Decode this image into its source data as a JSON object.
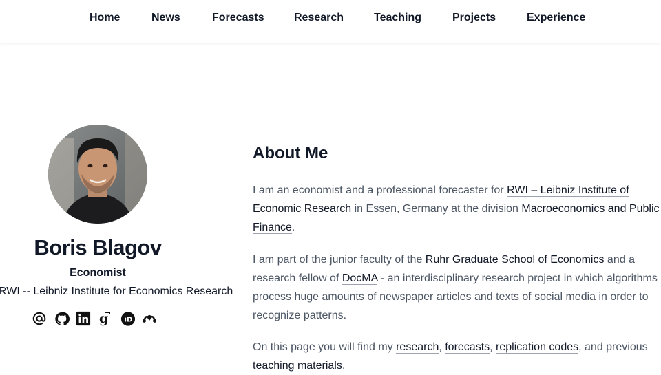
{
  "nav": {
    "items": [
      {
        "label": "Home"
      },
      {
        "label": "News"
      },
      {
        "label": "Forecasts"
      },
      {
        "label": "Research"
      },
      {
        "label": "Teaching"
      },
      {
        "label": "Projects"
      },
      {
        "label": "Experience"
      }
    ]
  },
  "profile": {
    "name": "Boris Blagov",
    "role": "Economist",
    "affiliation": "RWI -- Leibniz Institute for Economics Research",
    "social_icons": [
      "email-icon",
      "github-icon",
      "linkedin-icon",
      "google-scholar-icon",
      "orcid-icon",
      "mendeley-icon"
    ]
  },
  "about": {
    "title": "About Me",
    "p1": {
      "t1": "I am an economist and a professional forecaster for ",
      "l1": "RWI – Leibniz Institute of Economic Research",
      "t2": " in Essen, Germany at the division ",
      "l2": "Macroeconomics and Public Finance",
      "t3": "."
    },
    "p2": {
      "t1": "I am part of the junior faculty of the ",
      "l1": "Ruhr Graduate School of Economics",
      "t2": " and a research fellow of ",
      "l2": "DocMA",
      "t3": " - an interdisciplinary research project in which algorithms process huge amounts of newspaper articles and texts of social media in order to recognize patterns."
    },
    "p3": {
      "t1": "On this page you will find my ",
      "l1": "research",
      "t2": ", ",
      "l2": "forecasts",
      "t3": ", ",
      "l3": "replication codes",
      "t4": ", and previous ",
      "l4": "teaching materials",
      "t5": "."
    }
  },
  "colors": {
    "text_dark": "#111827",
    "text_body": "#4b5563",
    "link_underline": "#9ca3af",
    "nav_border": "#e5e7eb"
  }
}
